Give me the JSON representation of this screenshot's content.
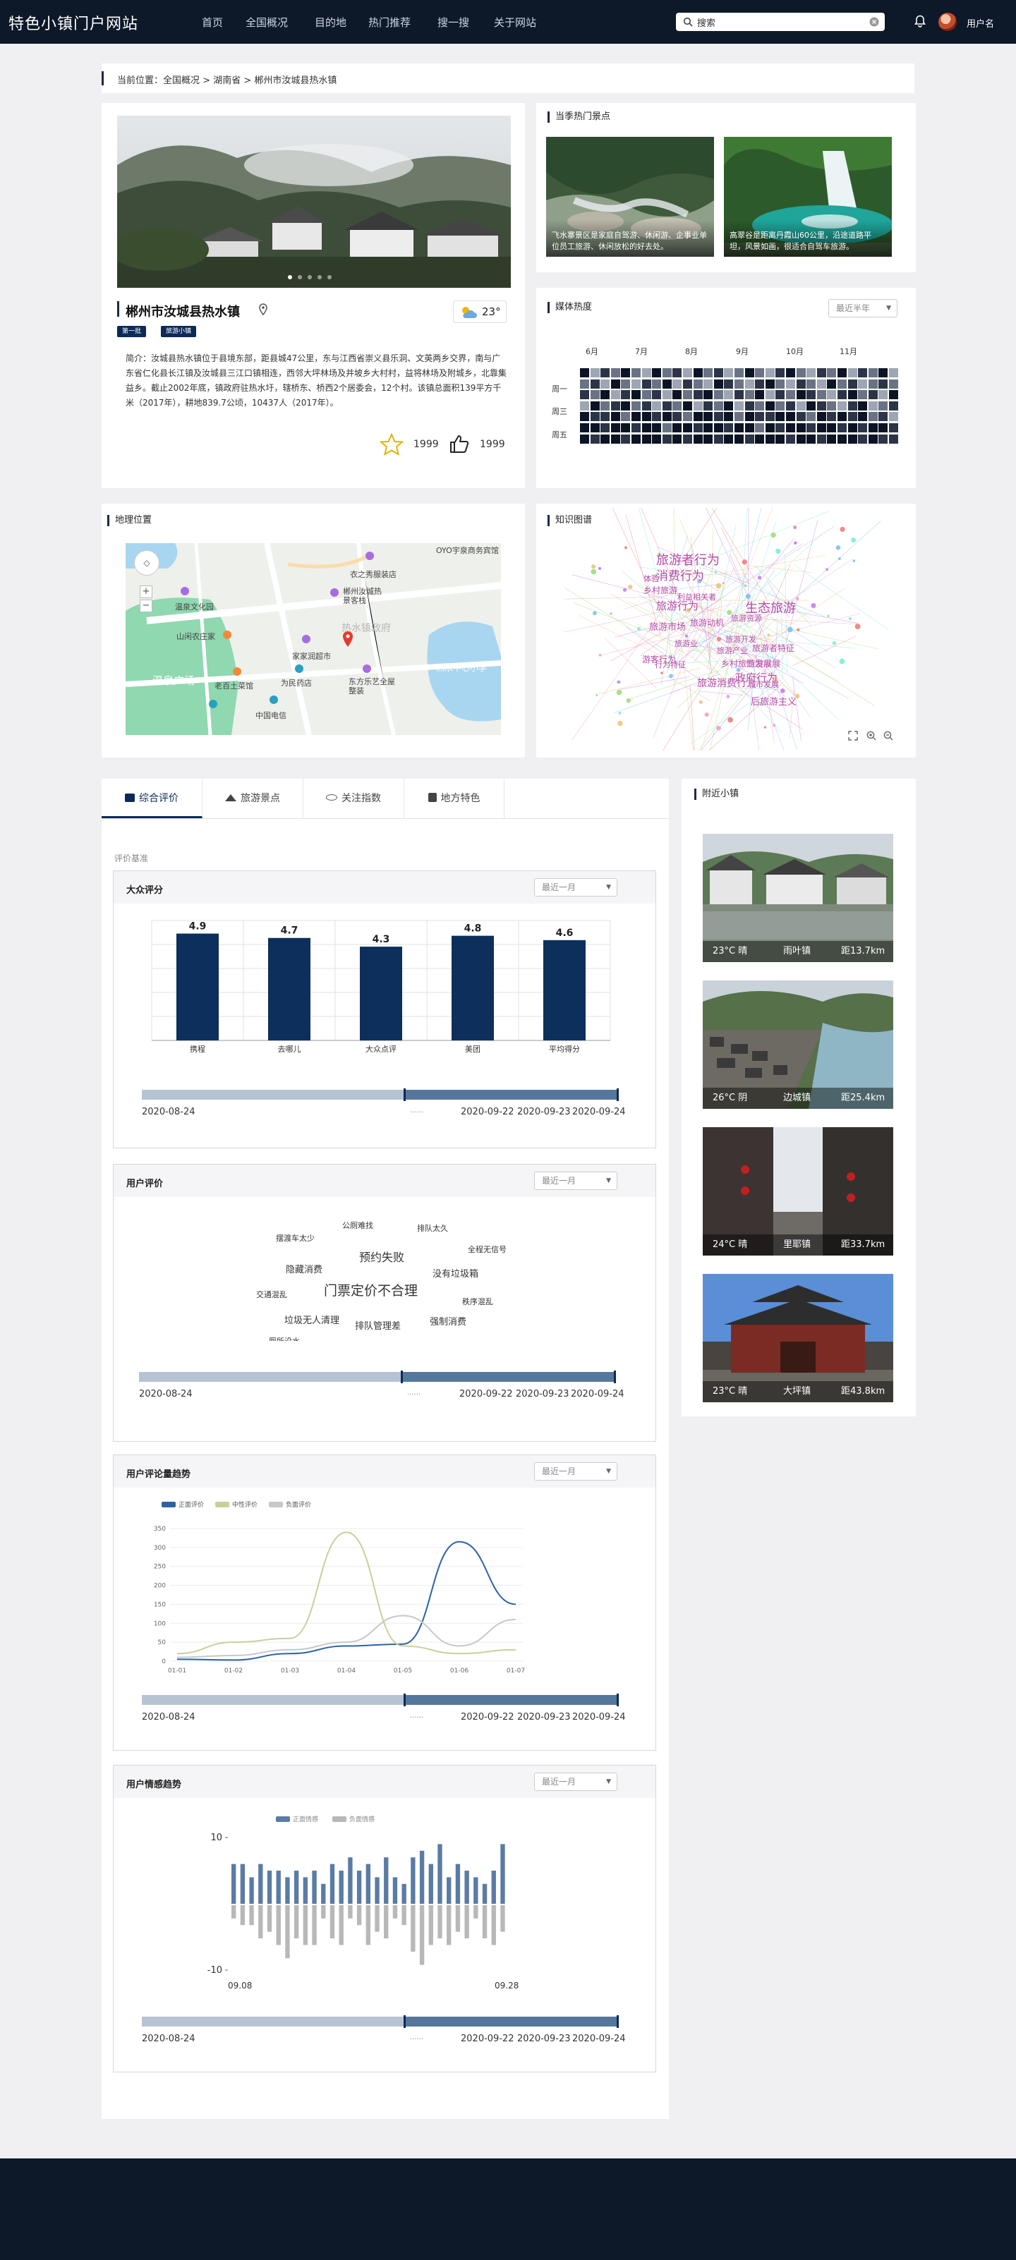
{
  "header": {
    "logo": "特色小镇门户网站",
    "nav": [
      "首页",
      "全国概况",
      "目的地",
      "热门推荐",
      "搜一搜",
      "关于网站"
    ],
    "search_value": "搜索",
    "user_name": "用户名"
  },
  "breadcrumb": {
    "prefix": "当前位置：",
    "items": [
      "全国概况",
      "湖南省",
      "郴州市汝城县热水镇"
    ],
    "separator": " > "
  },
  "town": {
    "name": "郴州市汝城县热水镇",
    "tags": [
      "第一批",
      "旅游小镇"
    ],
    "temperature": "23°",
    "description": "简介：汝城县热水镇位于县境东部，距县城47公里，东与江西省崇义县乐洞、文英两乡交界，南与广东省仁化县长江镇及汝城县三江口镇相连，西邻大坪林场及井坡乡大村村，益将林场及附城乡，北靠集益乡。截止2002年底，镇政府驻热水圩，辖桥东、桥西2个居委会，12个村。该镇总面积139平方千米（2017年），耕地839.7公顷，10437人（2017年）。",
    "favorites": "1999",
    "likes": "1999",
    "carousel_dots": 5,
    "carousel_active": 0
  },
  "hot_spots": {
    "title": "当季热门景点",
    "items": [
      {
        "caption": "飞水寨景区是家庭自驾游、休闲游、企事业单位员工旅游、休闲放松的好去处。"
      },
      {
        "caption": "高翠谷是距离丹霞山60公里，沿途道路平坦，风景如画，很适合自驾车旅游。"
      }
    ]
  },
  "media_heat": {
    "title": "媒体热度",
    "range": "最近半年",
    "months": [
      "6月",
      "7月",
      "8月",
      "9月",
      "10月",
      "11月"
    ],
    "days": [
      "周一",
      "周三",
      "周五"
    ],
    "levels": [
      [
        4,
        1,
        3,
        2,
        4,
        2,
        1,
        4,
        2,
        3,
        1,
        4,
        2,
        3,
        1,
        2,
        4,
        2,
        1,
        3,
        4,
        2,
        1,
        3,
        2,
        4,
        1,
        3,
        2,
        4,
        1
      ],
      [
        2,
        3,
        1,
        4,
        2,
        1,
        3,
        2,
        4,
        1,
        3,
        2,
        1,
        4,
        3,
        2,
        1,
        3,
        4,
        2,
        1,
        3,
        2,
        1,
        4,
        2,
        3,
        1,
        2,
        3,
        2
      ],
      [
        3,
        2,
        4,
        1,
        3,
        4,
        2,
        3,
        1,
        4,
        2,
        3,
        4,
        2,
        1,
        3,
        2,
        4,
        1,
        3,
        2,
        4,
        3,
        2,
        1,
        3,
        4,
        2,
        3,
        1,
        4
      ],
      [
        1,
        4,
        2,
        3,
        4,
        2,
        3,
        1,
        3,
        2,
        4,
        1,
        3,
        2,
        4,
        1,
        3,
        2,
        4,
        2,
        3,
        1,
        4,
        3,
        2,
        1,
        3,
        4,
        1,
        2,
        3
      ],
      [
        4,
        3,
        3,
        4,
        2,
        4,
        4,
        3,
        4,
        3,
        2,
        4,
        4,
        3,
        4,
        2,
        4,
        3,
        3,
        4,
        4,
        3,
        2,
        4,
        3,
        4,
        3,
        4,
        2,
        3,
        1
      ],
      [
        4,
        4,
        3,
        4,
        4,
        3,
        4,
        4,
        2,
        4,
        4,
        3,
        4,
        4,
        3,
        4,
        4,
        2,
        4,
        3,
        4,
        4,
        3,
        4,
        4,
        3,
        4,
        3,
        4,
        4,
        3
      ],
      [
        4,
        3,
        4,
        4,
        3,
        4,
        4,
        4,
        3,
        4,
        3,
        4,
        4,
        3,
        4,
        4,
        3,
        4,
        4,
        4,
        3,
        4,
        4,
        3,
        4,
        4,
        4,
        3,
        4,
        3,
        3
      ]
    ],
    "colors": [
      "#d3d8df",
      "#9ea6b3",
      "#6a7384",
      "#2c3547",
      "#0b1424"
    ]
  },
  "map": {
    "title": "地理位置",
    "labels": [
      "衣之秀服装店",
      "OYO宇泉商务宾馆",
      "郴州汝城热景客栈",
      "温泉文化园",
      "热水镇政府",
      "山闲农庄家",
      "家家润超市",
      "为民药店",
      "老百土菜馆",
      "东方乐艺全屋整装",
      "中国电信",
      "热水中心小学",
      "温泉广场"
    ]
  },
  "graph": {
    "title": "知识图谱",
    "words": [
      "旅游者行为",
      "消费行为",
      "旅游行为",
      "生态旅游",
      "乡村旅游",
      "旅游市场",
      "旅游业",
      "旅游产业",
      "旅游消费行为",
      "旅游发展",
      "政府行为",
      "城市发展",
      "旅游者特征",
      "后旅游主义",
      "体验",
      "利益相关者",
      "旅游开发",
      "游客行为",
      "行为特征",
      "旅游动机",
      "旅游资源",
      "乡村旅游发展"
    ]
  },
  "tabs": [
    "综合评价",
    "旅游景点",
    "关注指数",
    "地方特色"
  ],
  "review": {
    "basis_label": "评价基准",
    "range": "最近一月",
    "public_title": "大众评分",
    "user_title": "用户评价",
    "trend_title": "用户评论量趋势",
    "sentiment_title": "用户情感趋势",
    "slider": {
      "start": "2020-08-24",
      "mid": "......",
      "d1": "2020-09-22",
      "d2": "2020-09-23",
      "d3": "2020-09-24",
      "position": 0.55
    }
  },
  "words_cloud": [
    {
      "text": "公厕难找",
      "size": 11
    },
    {
      "text": "摆渡车太少",
      "size": 11
    },
    {
      "text": "排队太久",
      "size": 11
    },
    {
      "text": "全程无信号",
      "size": 11
    },
    {
      "text": "预约失败",
      "size": 16
    },
    {
      "text": "隐藏消费",
      "size": 13
    },
    {
      "text": "没有垃圾箱",
      "size": 13
    },
    {
      "text": "交通混乱",
      "size": 11
    },
    {
      "text": "门票定价不合理",
      "size": 19
    },
    {
      "text": "秩序混乱",
      "size": 11
    },
    {
      "text": "垃圾无人清理",
      "size": 13
    },
    {
      "text": "排队管理差",
      "size": 13
    },
    {
      "text": "强制消费",
      "size": 13
    },
    {
      "text": "厕所没水",
      "size": 11
    }
  ],
  "chart_data": [
    {
      "type": "bar",
      "title": "大众评分",
      "categories": [
        "携程",
        "去哪儿",
        "大众点评",
        "美团",
        "平均得分"
      ],
      "values": [
        4.9,
        4.7,
        4.3,
        4.8,
        4.6
      ],
      "ylim": [
        0,
        5.5
      ],
      "grid": true,
      "color": "#0d2f5c"
    },
    {
      "type": "line",
      "title": "用户评论量趋势",
      "categories": [
        "01-01",
        "01-02",
        "01-03",
        "01-04",
        "01-05",
        "01-06",
        "01-07"
      ],
      "yticks": [
        0,
        50,
        100,
        150,
        200,
        250,
        300,
        350
      ],
      "ylim": [
        0,
        350
      ],
      "legend_position": "top-left",
      "series": [
        {
          "name": "正面评价",
          "color": "#2b62a8",
          "values": [
            5,
            3,
            20,
            40,
            45,
            315,
            150
          ]
        },
        {
          "name": "中性评价",
          "color": "#c8d09a",
          "values": [
            20,
            50,
            60,
            340,
            40,
            20,
            30
          ]
        },
        {
          "name": "负面评价",
          "color": "#c8c8c8",
          "values": [
            10,
            15,
            30,
            50,
            120,
            40,
            110
          ]
        }
      ]
    },
    {
      "type": "bar",
      "title": "用户情感趋势",
      "x_labels": [
        "09.08",
        "09.28"
      ],
      "yticks": [
        10,
        -10
      ],
      "ylim": [
        -10,
        10
      ],
      "legend_position": "top-center",
      "series": [
        {
          "name": "正面情感",
          "color": "#5b7ba6",
          "values": [
            6,
            6,
            4,
            6,
            5,
            5,
            4,
            5,
            4,
            5,
            3,
            6,
            5,
            7,
            5,
            6,
            4,
            7,
            4,
            3,
            7,
            8,
            6,
            9,
            4,
            6,
            5,
            4,
            3,
            5,
            9
          ]
        },
        {
          "name": "负面情感",
          "color": "#b8b8b8",
          "values": [
            -2,
            -3,
            -3,
            -5,
            -4,
            -6,
            -8,
            -5,
            -6,
            -6,
            -2,
            -5,
            -6,
            -2,
            -3,
            -6,
            -4,
            -5,
            -2,
            -3,
            -7,
            -9,
            -6,
            -5,
            -6,
            -4,
            -5,
            -2,
            -5,
            -6,
            -4
          ]
        }
      ]
    }
  ],
  "nearby": {
    "title": "附近小镇",
    "items": [
      {
        "weather": "23°C 晴",
        "name": "雨叶镇",
        "distance": "距13.7km"
      },
      {
        "weather": "26°C 阴",
        "name": "边城镇",
        "distance": "距25.4km"
      },
      {
        "weather": "24°C 晴",
        "name": "里耶镇",
        "distance": "距33.7km"
      },
      {
        "weather": "23°C 晴",
        "name": "大坪镇",
        "distance": "距43.8km"
      }
    ]
  }
}
